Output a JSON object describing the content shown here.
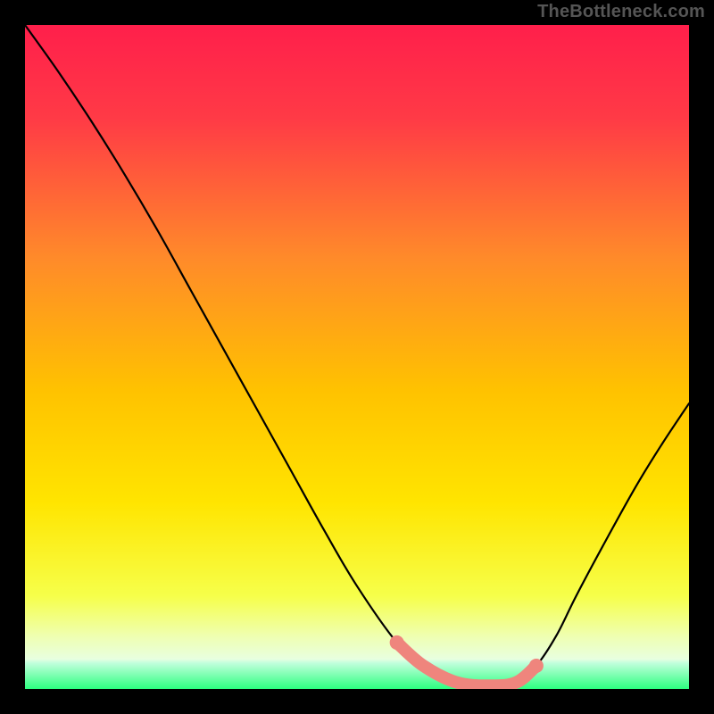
{
  "watermark": "TheBottleneck.com",
  "chart_data": {
    "type": "line",
    "title": "",
    "xlabel": "",
    "ylabel": "",
    "xlim": [
      0,
      1
    ],
    "ylim": [
      0,
      1
    ],
    "background_gradient": {
      "top_color": "#ff1f4b",
      "mid_color": "#ffd300",
      "green_band_color": "#2cff7f",
      "green_band_y_range": [
        0.0,
        0.04
      ]
    },
    "series": [
      {
        "name": "curve",
        "color": "#000000",
        "x": [
          0.0,
          0.05,
          0.1,
          0.15,
          0.2,
          0.25,
          0.3,
          0.35,
          0.4,
          0.45,
          0.5,
          0.56,
          0.6,
          0.65,
          0.7,
          0.74,
          0.77,
          0.8,
          0.83,
          0.87,
          0.92,
          0.96,
          1.0
        ],
        "y": [
          1.0,
          0.93,
          0.855,
          0.775,
          0.69,
          0.6,
          0.51,
          0.42,
          0.33,
          0.24,
          0.155,
          0.07,
          0.035,
          0.01,
          0.005,
          0.01,
          0.035,
          0.08,
          0.14,
          0.215,
          0.305,
          0.37,
          0.43
        ]
      },
      {
        "name": "highlight-band",
        "color": "#ef857d",
        "x": [
          0.56,
          0.6,
          0.65,
          0.7,
          0.74,
          0.77
        ],
        "y": [
          0.07,
          0.035,
          0.01,
          0.005,
          0.01,
          0.035
        ]
      }
    ]
  }
}
